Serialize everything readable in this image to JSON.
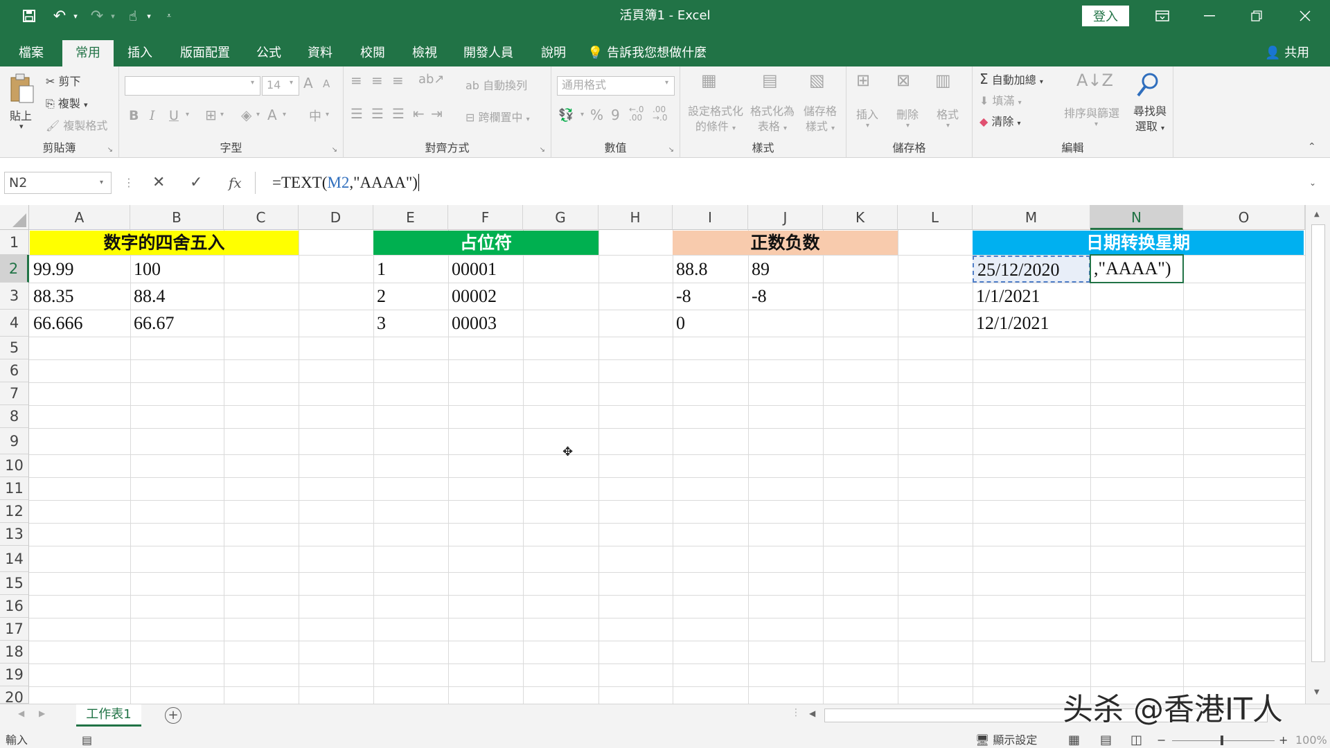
{
  "window": {
    "title": "活頁簿1 - Excel",
    "login_label": "登入"
  },
  "tabs": {
    "file": "檔案",
    "home": "常用",
    "insert": "插入",
    "layout": "版面配置",
    "formulas": "公式",
    "data": "資料",
    "review": "校閱",
    "view": "檢視",
    "developer": "開發人員",
    "help": "說明",
    "tell_me": "告訴我您想做什麼",
    "share": "共用"
  },
  "ribbon": {
    "clipboard": {
      "paste": "貼上",
      "cut": "剪下",
      "copy": "複製",
      "format_painter": "複製格式",
      "label": "剪貼簿"
    },
    "font": {
      "name": "",
      "size": "14",
      "label": "字型",
      "bold": "B",
      "italic": "I",
      "underline": "U",
      "grow": "A",
      "shrink": "A",
      "font_color": "A"
    },
    "alignment": {
      "wrap": "自動換列",
      "merge": "跨欄置中",
      "label": "對齊方式"
    },
    "number": {
      "format": "通用格式",
      "percent": "%",
      "comma": "9",
      "label": "數值"
    },
    "styles": {
      "conditional": "設定格式化的條件",
      "cond_line1": "設定格式化",
      "cond_line2": "的條件",
      "table_line1": "格式化為",
      "table_line2": "表格",
      "cell_line1": "儲存格",
      "cell_line2": "樣式",
      "label": "樣式"
    },
    "cells": {
      "insert": "插入",
      "delete": "刪除",
      "format": "格式",
      "label": "儲存格"
    },
    "editing": {
      "autosum": "自動加總",
      "fill": "填滿",
      "clear": "清除",
      "sort": "排序與篩選",
      "find_line1": "尋找與",
      "find_line2": "選取",
      "label": "編輯"
    }
  },
  "formula_bar": {
    "name_box": "N2",
    "formula_pre": "=TEXT(",
    "formula_ref": "M2",
    "formula_post": ",\"AAAA\")",
    "fx": "fx"
  },
  "columns": [
    "A",
    "B",
    "C",
    "D",
    "E",
    "F",
    "G",
    "H",
    "I",
    "J",
    "K",
    "L",
    "M",
    "N",
    "O"
  ],
  "rows": [
    "1",
    "2",
    "3",
    "4",
    "5",
    "6",
    "7",
    "8",
    "9",
    "10",
    "11",
    "12",
    "13",
    "14",
    "15",
    "16",
    "17",
    "18",
    "19",
    "20"
  ],
  "sections": {
    "rounding": {
      "title": "数字的四舍五入",
      "color": "#ffff00"
    },
    "placeholder": {
      "title": "占位符",
      "color": "#00b050"
    },
    "posneg": {
      "title": "正数负数",
      "color": "#f8cbad"
    },
    "weekday": {
      "title": "日期转换星期",
      "color": "#00b0f0"
    }
  },
  "cells": {
    "A2": "99.99",
    "B2": "100",
    "A3": "88.35",
    "B3": "88.4",
    "A4": "66.666",
    "B4": "66.67",
    "E2": "1",
    "F2": "00001",
    "E3": "2",
    "F3": "00002",
    "E4": "3",
    "F4": "00003",
    "I2": "88.8",
    "J2": "89",
    "I3": "-8",
    "J3": "-8",
    "I4": "0",
    "M2": "25/12/2020",
    "N2": ",\"AAAA\")",
    "M3": "1/1/2021",
    "M4": "12/1/2021"
  },
  "sheet_tab": "工作表1",
  "status": {
    "mode": "輸入",
    "display_settings": "顯示設定",
    "zoom": "100%"
  },
  "watermark": "头杀 @香港IT人"
}
